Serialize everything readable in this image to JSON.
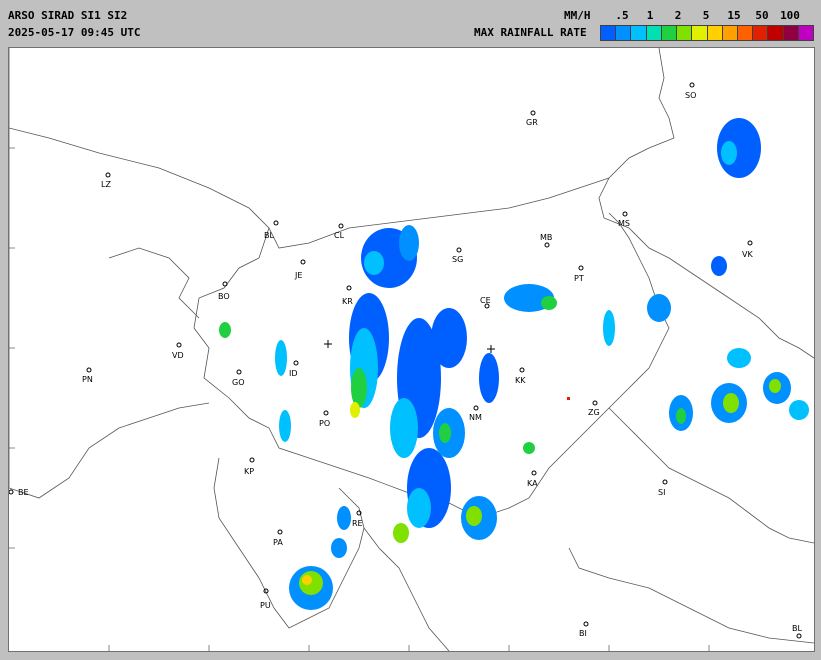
{
  "header": {
    "station": "ARSO SIRAD SI1 SI2",
    "timestamp": "2025-05-17 09:45 UTC"
  },
  "legend": {
    "unit": "MM/H",
    "title": "MAX RAINFALL RATE",
    "values": [
      ".5",
      "1",
      "2",
      "5",
      "15",
      "50",
      "100"
    ],
    "colors": [
      "#0060ff",
      "#0090ff",
      "#00c0ff",
      "#00e0b0",
      "#20d040",
      "#80e000",
      "#e0f000",
      "#ffd000",
      "#ffa000",
      "#ff6000",
      "#e02000",
      "#c00000",
      "#900040",
      "#c000c0"
    ]
  },
  "map": {
    "cities": [
      {
        "code": "SO"
      },
      {
        "code": "GR"
      },
      {
        "code": "LZ"
      },
      {
        "code": "MS"
      },
      {
        "code": "BL"
      },
      {
        "code": "CL"
      },
      {
        "code": "MB"
      },
      {
        "code": "VK"
      },
      {
        "code": "JE"
      },
      {
        "code": "SG"
      },
      {
        "code": "PT"
      },
      {
        "code": "BO"
      },
      {
        "code": "KR"
      },
      {
        "code": "CE"
      },
      {
        "code": "VD"
      },
      {
        "code": "ID"
      },
      {
        "code": "KK"
      },
      {
        "code": "PN"
      },
      {
        "code": "GO"
      },
      {
        "code": "ZG"
      },
      {
        "code": "NM"
      },
      {
        "code": "PO"
      },
      {
        "code": "KP"
      },
      {
        "code": "KA"
      },
      {
        "code": "SI"
      },
      {
        "code": "BE"
      },
      {
        "code": "RE"
      },
      {
        "code": "PA"
      },
      {
        "code": "PU"
      },
      {
        "code": "BI"
      },
      {
        "code": "BL"
      }
    ],
    "radar_sites": 2
  }
}
